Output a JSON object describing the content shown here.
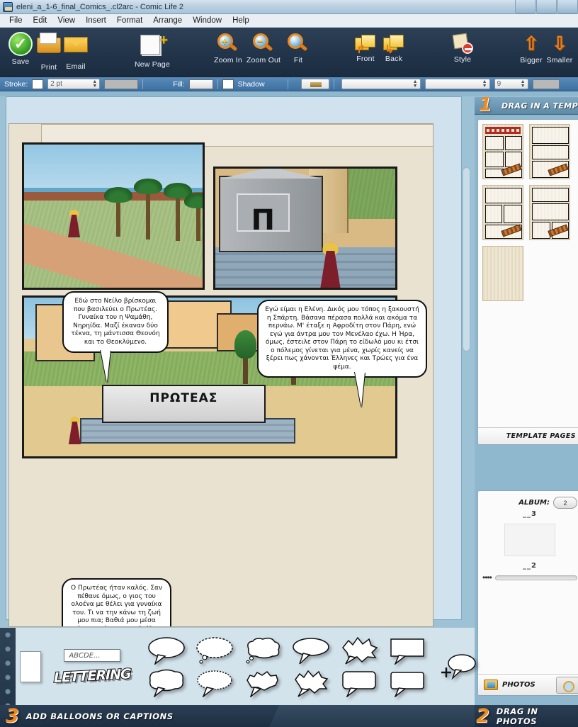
{
  "window": {
    "title": "eleni_a_1-6_final_Comics_.cl2arc - Comic Life 2",
    "app_icon": "comic-life-app-icon"
  },
  "menubar": {
    "items": [
      "File",
      "Edit",
      "View",
      "Insert",
      "Format",
      "Arrange",
      "Window",
      "Help"
    ]
  },
  "toolbar": {
    "items": [
      {
        "label": "Save",
        "icon": "save-check-icon"
      },
      {
        "label": "Print",
        "icon": "printer-icon"
      },
      {
        "label": "Email",
        "icon": "envelope-icon"
      },
      {
        "label": "New  Page",
        "icon": "new-page-icon"
      },
      {
        "label": "Zoom In",
        "icon": "zoom-in-icon"
      },
      {
        "label": "Zoom Out",
        "icon": "zoom-out-icon"
      },
      {
        "label": "Fit",
        "icon": "zoom-fit-icon"
      },
      {
        "label": "Front",
        "icon": "bring-front-icon"
      },
      {
        "label": "Back",
        "icon": "send-back-icon"
      },
      {
        "label": "Style",
        "icon": "style-icon"
      },
      {
        "label": "Bigger",
        "icon": "arrow-up-bigger-icon"
      },
      {
        "label": "Smaller",
        "icon": "arrow-down-smaller-icon"
      }
    ]
  },
  "propbar": {
    "stroke_label": "Stroke:",
    "stroke_color": "#ffffff",
    "stroke_width": "2 pt",
    "stroke_style_color": "#b8b8b8",
    "fill_label": "Fill:",
    "fill_color": "#eeeeee",
    "shadow_label": "Shadow",
    "shadow_checked": false,
    "font_family": "",
    "font_style": "",
    "font_size": "9",
    "text_color": "#b8b8b8"
  },
  "canvas": {
    "panels": [
      {
        "name": "panel-nile",
        "scene": "nile-riverbank-with-palms",
        "balloon": {
          "text": "Εδώ στο Νείλο βρίσκομαι που βασιλεύει ο Πρωτέας. Γυναίκα του η Ψαμάθη, Νηρηίδα. Μαζί έκαναν δύο τέκνα, τη μάντισσα Θεονόη και το Θεοκλύμενο."
        }
      },
      {
        "name": "panel-monument",
        "scene": "grey-monument-with-pi-and-helen",
        "monument_letter": "Π",
        "balloon": {
          "text": "Εγώ είμαι η Ελένη. Δικός μου τόπος η ξακουστή η Σπάρτη. Βάσανα πέρασα πολλά και ακόμα τα περνάω. Μ' έταξε η Αφροδίτη στον Πάρη, ενώ εγώ για άντρα μου τον Μενέλαο έχω. Η Ήρα, όμως, έστειλε στον Πάρη το είδωλό μου κι έτσι ο πόλεμος γίνεται για μένα, χωρίς κανείς να ξέρει πως χάνονται Έλληνες και Τρώες για ένα ψέμα."
        }
      },
      {
        "name": "panel-tomb",
        "scene": "palace-courtyard-with-tomb",
        "tomb_inscription": "ΠΡΩΤΕΑΣ",
        "balloon": {
          "text": "Ο Πρωτέας ήταν καλός. Σαν πέθανε όμως, ο γιος του ολοένα με θέλει για γυναίκα του. Τι να την κάνω τη ζωή μου πια; Βαθιά μου μέσα όμως υπάρχει μια ελπίδα πως θα ξαναγυρίσω."
        }
      }
    ]
  },
  "sidebar": {
    "templates": {
      "header_number": "1",
      "header_label": "DRAG IN A TEMPLATE",
      "footer_label": "TEMPLATE PAGES",
      "thumbnails": [
        {
          "name": "template-thumb-1",
          "has_title_bar": true
        },
        {
          "name": "template-thumb-2",
          "has_title_bar": false
        },
        {
          "name": "template-thumb-3",
          "has_title_bar": false
        },
        {
          "name": "template-thumb-4",
          "has_title_bar": false
        },
        {
          "name": "template-thumb-blank",
          "has_title_bar": false
        }
      ]
    },
    "photos": {
      "album_label": "ALBUM:",
      "album_value": "2",
      "count_top": "__3",
      "count_bottom": "__2",
      "zoom_dots": "••••",
      "footer_label": "PHOTOS",
      "search_icon": "photo-search-icon"
    }
  },
  "tray": {
    "plain_panel": "plain-panel-shape",
    "text_sample": "ABCDE...",
    "lettering_label": "LETTERING",
    "balloon_shapes": [
      "speech-oval",
      "thought-cloud-dashed",
      "speech-cloud",
      "speech-oval-wide",
      "speech-burst-star",
      "caption-rectangle",
      "speech-rounded-jagged",
      "speech-scalloped",
      "speech-rounded-box",
      "speech-spiky-small",
      "speech-burst-small",
      "caption-rounded"
    ],
    "add_balloon_icon": "add-balloon-plus-icon"
  },
  "status": {
    "step3_number": "3",
    "step3_label": "ADD BALLOONS OR CAPTIONS",
    "step2_number": "2",
    "step2_label": "DRAG IN PHOTOS"
  }
}
